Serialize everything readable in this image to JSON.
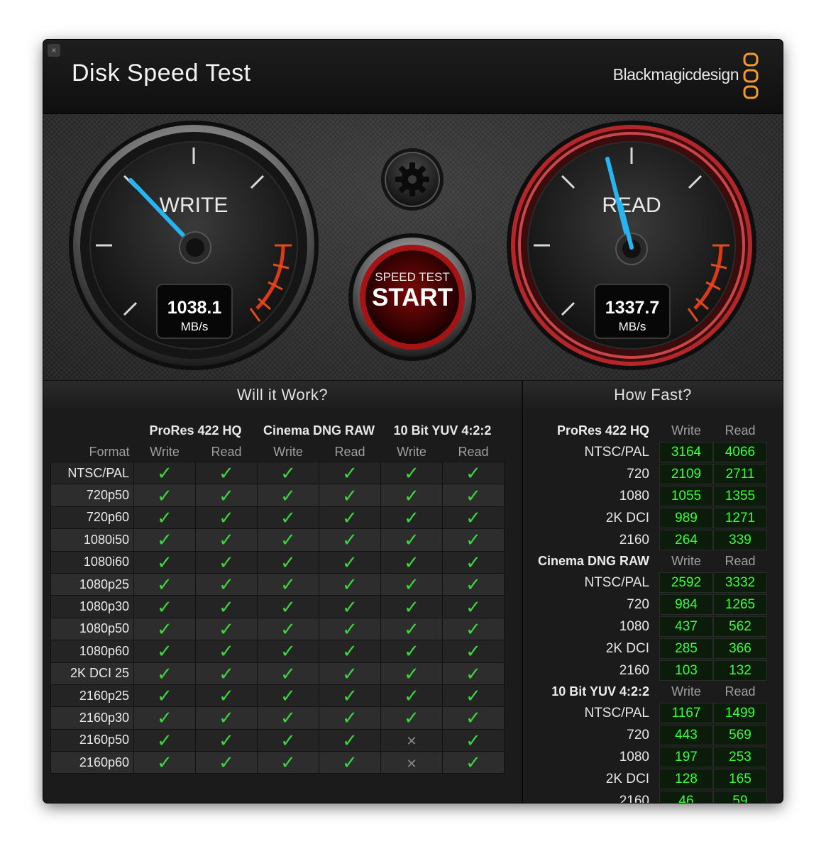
{
  "window": {
    "title": "Disk Speed Test",
    "brand": "Blackmagicdesign",
    "close_glyph": "×"
  },
  "gauges": {
    "write": {
      "label": "WRITE",
      "value": "1038.1",
      "unit": "MB/s"
    },
    "read": {
      "label": "READ",
      "value": "1337.7",
      "unit": "MB/s"
    }
  },
  "start_button": {
    "line1": "SPEED TEST",
    "line2": "START"
  },
  "settings_icon": "gear-icon",
  "will_it_work": {
    "heading": "Will it Work?",
    "format_label": "Format",
    "groups": [
      "ProRes 422 HQ",
      "Cinema DNG RAW",
      "10 Bit YUV 4:2:2"
    ],
    "sub_headers": [
      "Write",
      "Read",
      "Write",
      "Read",
      "Write",
      "Read"
    ],
    "check_glyph": "✓",
    "cross_glyph": "✕",
    "rows": [
      {
        "format": "NTSC/PAL",
        "results": [
          true,
          true,
          true,
          true,
          true,
          true
        ]
      },
      {
        "format": "720p50",
        "results": [
          true,
          true,
          true,
          true,
          true,
          true
        ]
      },
      {
        "format": "720p60",
        "results": [
          true,
          true,
          true,
          true,
          true,
          true
        ]
      },
      {
        "format": "1080i50",
        "results": [
          true,
          true,
          true,
          true,
          true,
          true
        ]
      },
      {
        "format": "1080i60",
        "results": [
          true,
          true,
          true,
          true,
          true,
          true
        ]
      },
      {
        "format": "1080p25",
        "results": [
          true,
          true,
          true,
          true,
          true,
          true
        ]
      },
      {
        "format": "1080p30",
        "results": [
          true,
          true,
          true,
          true,
          true,
          true
        ]
      },
      {
        "format": "1080p50",
        "results": [
          true,
          true,
          true,
          true,
          true,
          true
        ]
      },
      {
        "format": "1080p60",
        "results": [
          true,
          true,
          true,
          true,
          true,
          true
        ]
      },
      {
        "format": "2K DCI 25",
        "results": [
          true,
          true,
          true,
          true,
          true,
          true
        ]
      },
      {
        "format": "2160p25",
        "results": [
          true,
          true,
          true,
          true,
          true,
          true
        ]
      },
      {
        "format": "2160p30",
        "results": [
          true,
          true,
          true,
          true,
          true,
          true
        ]
      },
      {
        "format": "2160p50",
        "results": [
          true,
          true,
          true,
          true,
          false,
          true
        ]
      },
      {
        "format": "2160p60",
        "results": [
          true,
          true,
          true,
          true,
          false,
          true
        ]
      }
    ]
  },
  "how_fast": {
    "heading": "How Fast?",
    "write_label": "Write",
    "read_label": "Read",
    "groups": [
      {
        "name": "ProRes 422 HQ",
        "rows": [
          {
            "format": "NTSC/PAL",
            "write": "3164",
            "read": "4066"
          },
          {
            "format": "720",
            "write": "2109",
            "read": "2711"
          },
          {
            "format": "1080",
            "write": "1055",
            "read": "1355"
          },
          {
            "format": "2K DCI",
            "write": "989",
            "read": "1271"
          },
          {
            "format": "2160",
            "write": "264",
            "read": "339"
          }
        ]
      },
      {
        "name": "Cinema DNG RAW",
        "rows": [
          {
            "format": "NTSC/PAL",
            "write": "2592",
            "read": "3332"
          },
          {
            "format": "720",
            "write": "984",
            "read": "1265"
          },
          {
            "format": "1080",
            "write": "437",
            "read": "562"
          },
          {
            "format": "2K DCI",
            "write": "285",
            "read": "366"
          },
          {
            "format": "2160",
            "write": "103",
            "read": "132"
          }
        ]
      },
      {
        "name": "10 Bit YUV 4:2:2",
        "rows": [
          {
            "format": "NTSC/PAL",
            "write": "1167",
            "read": "1499"
          },
          {
            "format": "720",
            "write": "443",
            "read": "569"
          },
          {
            "format": "1080",
            "write": "197",
            "read": "253"
          },
          {
            "format": "2K DCI",
            "write": "128",
            "read": "165"
          },
          {
            "format": "2160",
            "write": "46",
            "read": "59"
          }
        ]
      }
    ]
  },
  "colors": {
    "needle": "#28b4f0",
    "accent_orange": "#f39a2b",
    "read_ring": "#b3262a",
    "ok_green": "#3ed43e",
    "number_green": "#39ff39"
  }
}
